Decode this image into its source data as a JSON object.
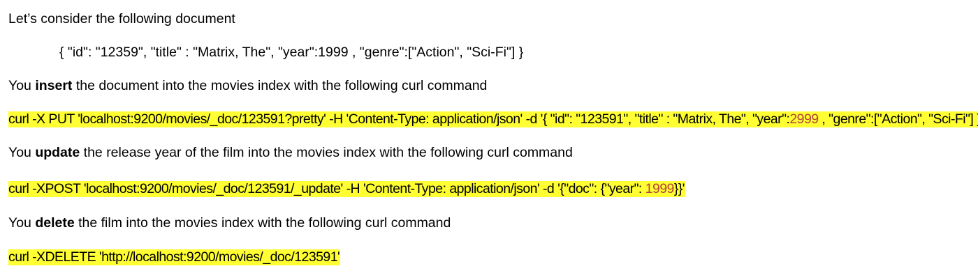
{
  "intro": "Let’s consider the following document",
  "document_json": "{ \"id\": \"12359\", \"title\" : \"Matrix, The\", \"year\":1999 , \"genre\":[\"Action\", \"Sci-Fi\"] }",
  "insert": {
    "prefix": "You ",
    "keyword": "insert",
    "suffix": " the document into the movies index with the following curl command",
    "command_before": "curl -X PUT 'localhost:9200/movies/_doc/123591?pretty' -H 'Content-Type: application/json' -d '{ \"id\": \"123591\", \"title\" : \"Matrix, The\", \"year\":",
    "command_value": "2999",
    "command_after": " , \"genre\":[\"Action\", \"Sci-Fi\"] }'"
  },
  "update": {
    "prefix": "You ",
    "keyword": "update",
    "suffix": " the release year of the film into the movies index with the following curl command",
    "command_before": "curl -XPOST 'localhost:9200/movies/_doc/123591/_update' -H 'Content-Type: application/json' -d '{\"doc\": {\"year\": ",
    "command_value": "1999",
    "command_after": "}}'"
  },
  "delete": {
    "prefix": "You ",
    "keyword": "delete",
    "suffix": " the film into the movies index with the following curl command",
    "command": "curl -XDELETE 'http://localhost:9200/movies/_doc/123591'"
  },
  "colors": {
    "highlight": "#ffff33",
    "value_text": "#b5433b",
    "text": "#000000"
  }
}
